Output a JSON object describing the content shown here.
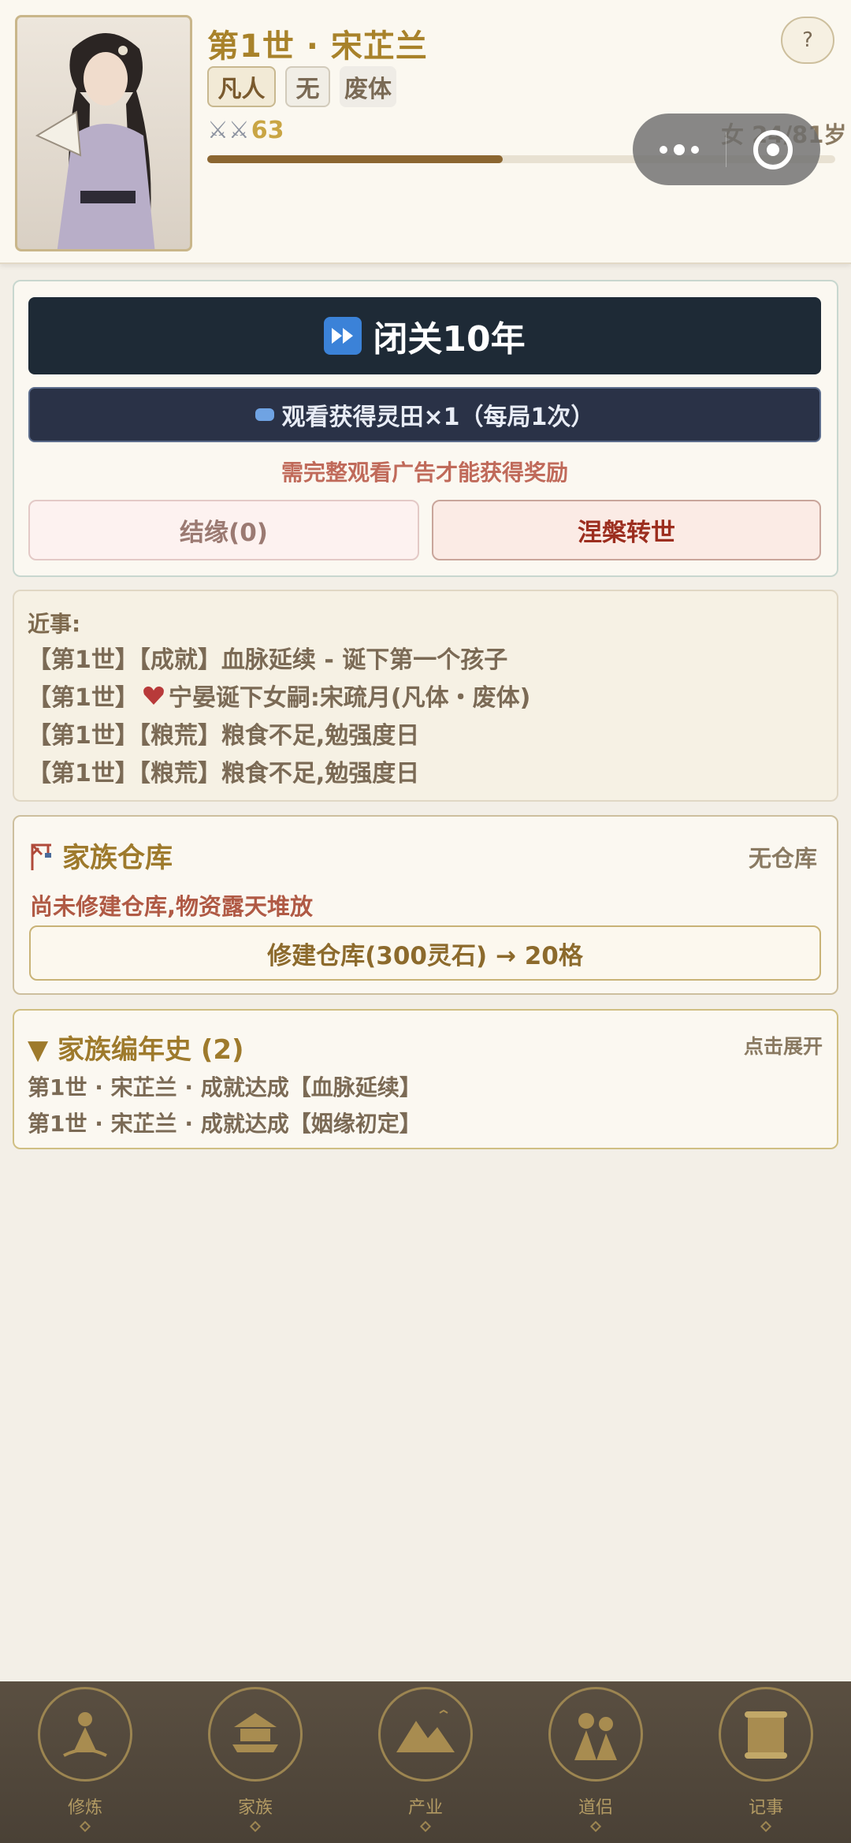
{
  "header": {
    "title": "第1世 · 宋芷兰",
    "tags": [
      "凡人",
      "无",
      "废体"
    ],
    "power_icons": "⚔⚔",
    "power_value": "63",
    "gender_age": "女 24/81岁",
    "lifespan_progress": 0.47,
    "info_button": "?"
  },
  "actions": {
    "retreat_label": "闭关10年",
    "ad_label": "观看获得灵田×1（每局1次）",
    "ad_note": "需完整观看广告才能获得奖励",
    "marriage_label": "结缘(0)",
    "rebirth_label": "涅槃转世"
  },
  "news": {
    "title": "近事:",
    "lines": [
      "【第1世】【成就】血脉延续 - 诞下第一个孩子",
      "【第1世】",
      "宁晏诞下女嗣:宋疏月(凡体・废体)",
      "【第1世】【粮荒】粮食不足,勉强度日",
      "【第1世】【粮荒】粮食不足,勉强度日"
    ]
  },
  "storage": {
    "title": "家族仓库",
    "status": "无仓库",
    "note": "尚未修建仓库,物资露天堆放",
    "build_label": "修建仓库(300灵石) → 20格"
  },
  "chronicle": {
    "title": "▼ 家族编年史 (2)",
    "expand": "点击展开",
    "entries": [
      "第1世 · 宋芷兰 · 成就达成【血脉延续】",
      "第1世 · 宋芷兰 · 成就达成【姻缘初定】"
    ]
  },
  "tabs": [
    "修炼",
    "家族",
    "产业",
    "道侣",
    "记事"
  ],
  "colors": {
    "gold": "#a8822a",
    "dark_button": "#1e2a36",
    "red_text": "#9c2e1f"
  }
}
